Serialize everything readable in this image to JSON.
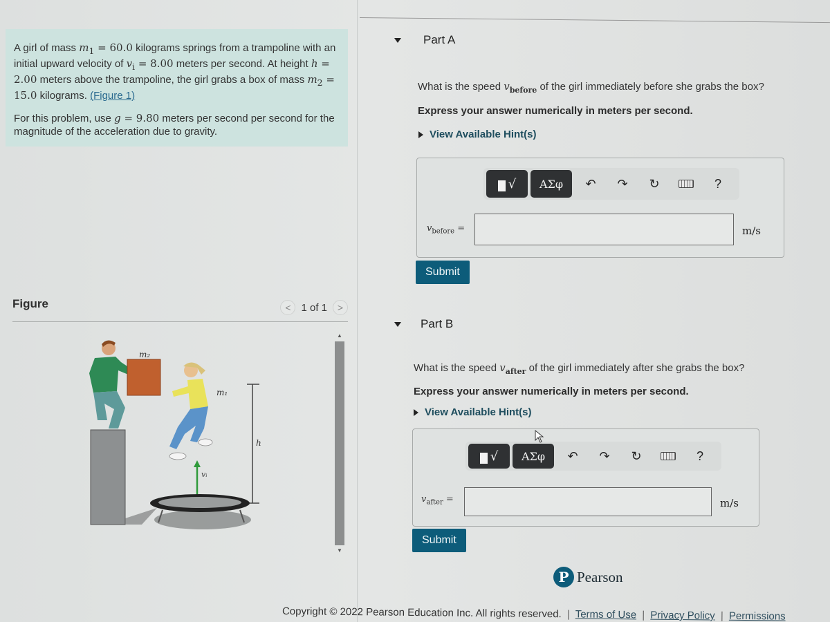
{
  "problem": {
    "paragraph1": {
      "t1": "A girl of mass ",
      "m1_sym": "m",
      "m1_sub": "1",
      "m1_val": " = 60.0",
      "t2": " kilograms springs from a trampoline with an initial upward velocity of ",
      "vi_sym": "v",
      "vi_sub": "i",
      "vi_val": " = 8.00",
      "t3": " meters per second. At height ",
      "h_sym": "h",
      "h_val": " = 2.00",
      "t4": " meters above the trampoline, the girl grabs a box of mass ",
      "m2_sym": "m",
      "m2_sub": "2",
      "m2_val": " = 15.0",
      "t5": " kilograms. ",
      "figure_link": "(Figure 1)"
    },
    "paragraph2": {
      "t1": "For this problem, use ",
      "g_sym": "g",
      "g_val": " = 9.80",
      "t2": " meters per second per second for the magnitude of the acceleration due to gravity."
    }
  },
  "figure": {
    "title": "Figure",
    "page_indicator": "1 of 1",
    "prev_icon": "<",
    "next_icon": ">",
    "labels": {
      "m2": "m₂",
      "m1": "m₁",
      "h": "h",
      "vi": "vᵢ"
    },
    "colors": {
      "box": "#c0602e",
      "boy_shirt": "#2e8a55",
      "girl_shirt": "#e9e25a",
      "jeans": "#5b93c9",
      "arrow": "#2f9a3a"
    }
  },
  "parts": [
    {
      "title": "Part A",
      "question_pre": "What is the speed ",
      "var_sym": "v",
      "var_sub": "before",
      "question_post": " of the girl immediately before she grabs the box?",
      "instruction": "Express your answer numerically in meters per second.",
      "hint_label": "View Available Hint(s)",
      "input_value": "",
      "unit": "m/s",
      "submit_label": "Submit"
    },
    {
      "title": "Part B",
      "question_pre": "What is the speed ",
      "var_sym": "v",
      "var_sub": "after",
      "question_post": " of the girl immediately after she grabs the box?",
      "instruction": "Express your answer numerically in meters per second.",
      "hint_label": "View Available Hint(s)",
      "input_value": "",
      "unit": "m/s",
      "submit_label": "Submit"
    }
  ],
  "toolbar": {
    "template_icon": "√",
    "greek_label": "ΑΣφ",
    "undo_icon": "↶",
    "redo_icon": "↷",
    "reset_icon": "↻",
    "help_icon": "?"
  },
  "brand": {
    "logo_letter": "P",
    "name": "Pearson",
    "color": "#0d5c7a"
  },
  "footer": {
    "copyright": "Copyright © 2022 Pearson Education Inc. All rights reserved.",
    "sep": "|",
    "links": [
      "Terms of Use",
      "Privacy Policy",
      "Permissions"
    ]
  }
}
